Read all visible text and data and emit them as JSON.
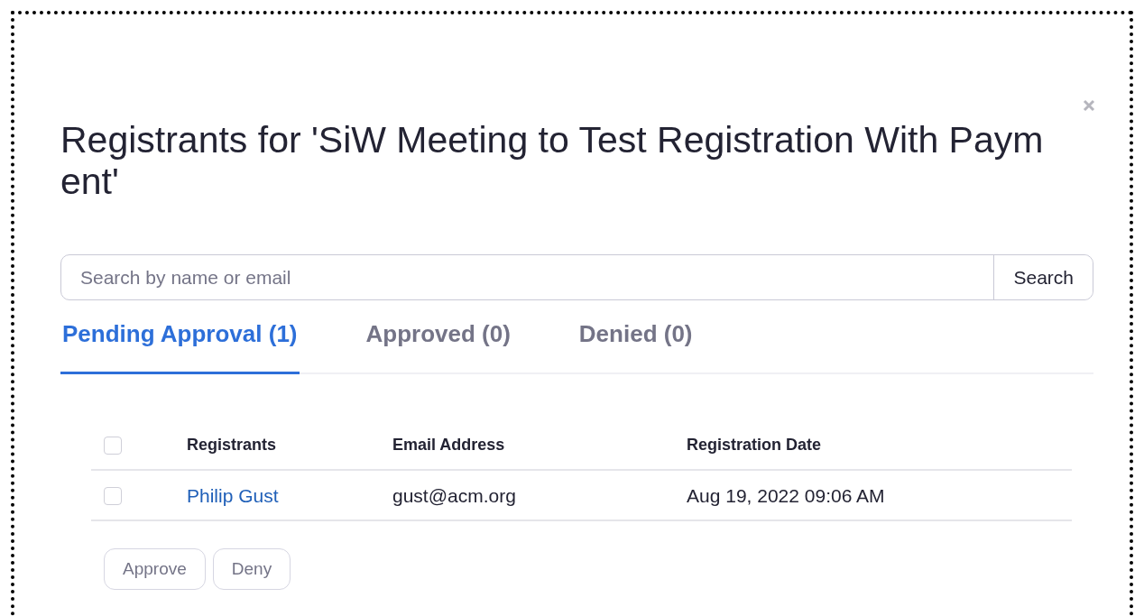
{
  "dialog": {
    "title": "Registrants for 'SiW Meeting to Test Registration With Payment'"
  },
  "search": {
    "placeholder": "Search by name or email",
    "button": "Search"
  },
  "tabs": [
    {
      "label": "Pending Approval (1)",
      "selected": true
    },
    {
      "label": "Approved (0)",
      "selected": false
    },
    {
      "label": "Denied (0)",
      "selected": false
    }
  ],
  "table": {
    "select_all_checked": false,
    "columns": [
      "Registrants",
      "Email Address",
      "Registration Date"
    ],
    "rows": [
      {
        "checked": false,
        "name": "Philip Gust",
        "email": "gust@acm.org",
        "date": "Aug 19, 2022 09:06 AM"
      }
    ]
  },
  "actions": [
    {
      "label": "Approve"
    },
    {
      "label": "Deny"
    }
  ]
}
